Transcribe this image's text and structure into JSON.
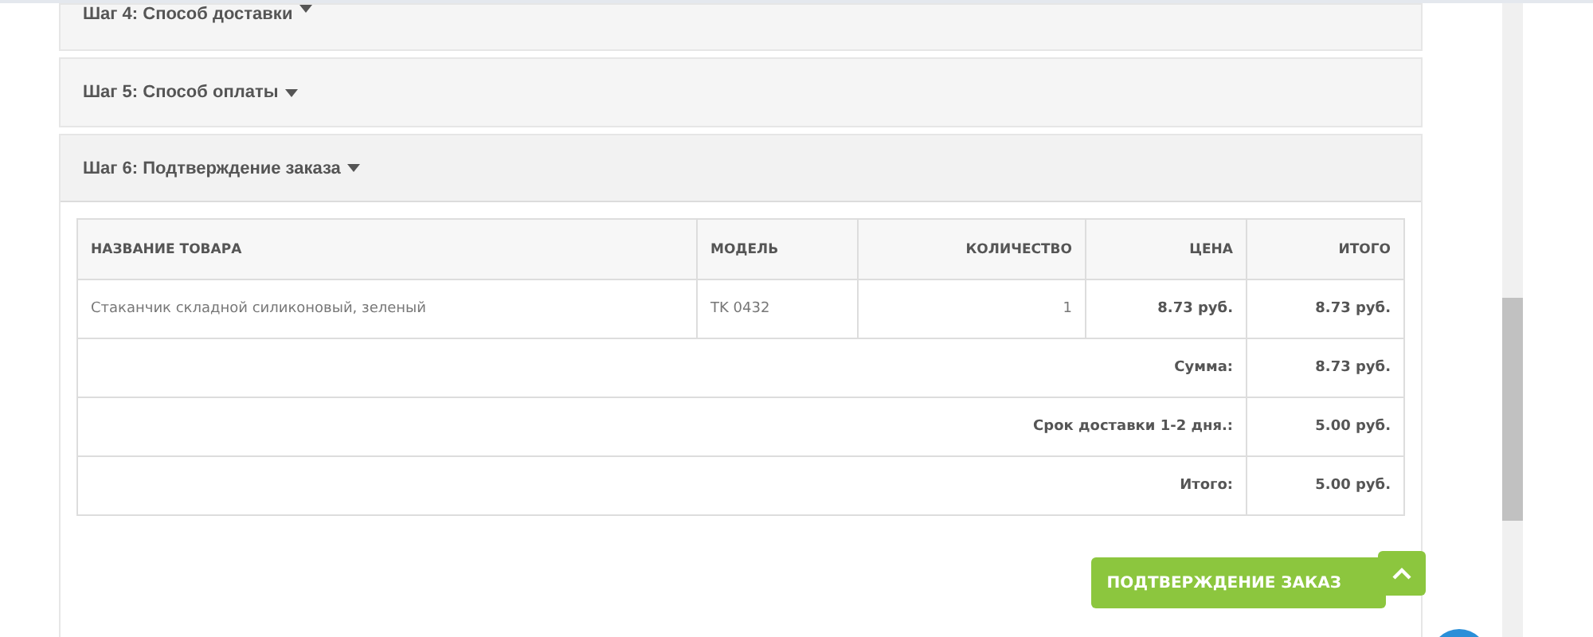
{
  "steps": [
    {
      "title": "Шаг 4: Способ доставки",
      "expanded": false
    },
    {
      "title": "Шаг 5: Способ оплаты",
      "expanded": false
    },
    {
      "title": "Шаг 6: Подтверждение заказа",
      "expanded": true
    }
  ],
  "table": {
    "columns": [
      "НАЗВАНИЕ ТОВАРА",
      "МОДЕЛЬ",
      "КОЛИЧЕСТВО",
      "ЦЕНА",
      "ИТОГО"
    ],
    "rows": [
      {
        "name": "Стаканчик складной силиконовый, зеленый",
        "model": "TK 0432",
        "quantity": "1",
        "price": "8.73 руб.",
        "total": "8.73 руб."
      }
    ],
    "totals": [
      {
        "label": "Сумма:",
        "value": "8.73 руб."
      },
      {
        "label": "Срок доставки 1-2 дня.:",
        "value": "5.00 руб."
      },
      {
        "label": "Итого:",
        "value": "5.00 руб."
      }
    ]
  },
  "confirm_button": "ПОДТВЕРЖДЕНИЕ ЗАКАЗ"
}
